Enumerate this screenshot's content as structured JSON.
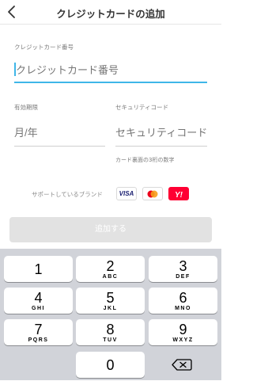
{
  "header": {
    "title": "クレジットカードの追加"
  },
  "card_number": {
    "label": "クレジットカード番号",
    "placeholder": "クレジットカード番号"
  },
  "expiry": {
    "label": "有効期限",
    "placeholder": "月/年"
  },
  "security": {
    "label": "セキュリティコード",
    "placeholder": "セキュリティコード",
    "hint": "カード裏面の3桁の数字"
  },
  "brands": {
    "label": "サポートしているブランド",
    "items": [
      "VISA",
      "mastercard",
      "Y!"
    ]
  },
  "submit": {
    "label": "追加する"
  },
  "keypad": {
    "keys": [
      {
        "num": "1",
        "letters": ""
      },
      {
        "num": "2",
        "letters": "ABC"
      },
      {
        "num": "3",
        "letters": "DEF"
      },
      {
        "num": "4",
        "letters": "GHI"
      },
      {
        "num": "5",
        "letters": "JKL"
      },
      {
        "num": "6",
        "letters": "MNO"
      },
      {
        "num": "7",
        "letters": "PQRS"
      },
      {
        "num": "8",
        "letters": "TUV"
      },
      {
        "num": "9",
        "letters": "WXYZ"
      },
      {
        "num": "0",
        "letters": ""
      }
    ]
  },
  "colors": {
    "accent": "#3fb6e8",
    "mastercard_red": "#eb001b",
    "mastercard_orange": "#f79e1b",
    "ymobile_red": "#ff0033",
    "visa_blue": "#1a1f71"
  }
}
